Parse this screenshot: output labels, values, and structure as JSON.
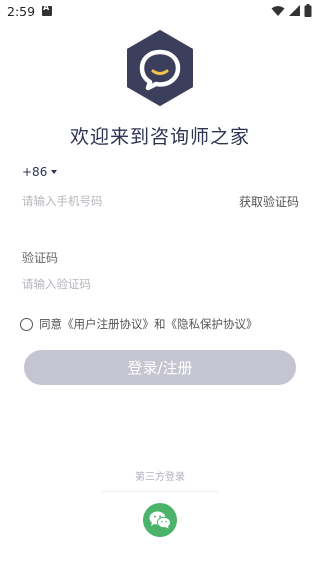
{
  "status_bar": {
    "time": "2:59",
    "notification_icon": "a-badge-icon",
    "icons": [
      "wifi-icon",
      "signal-icon",
      "battery-icon"
    ]
  },
  "logo": {
    "icon": "chat-bubble-logo",
    "color": "#3c3f5c"
  },
  "welcome_title": "欢迎来到咨询师之家",
  "phone": {
    "country_code": "+86",
    "placeholder": "请输入手机号码",
    "get_code_label": "获取验证码"
  },
  "code": {
    "label": "验证码",
    "placeholder": "请输入验证码"
  },
  "agreement": {
    "text": "同意《用户注册协议》和《隐私保护协议》"
  },
  "login_button": {
    "label": "登录/注册",
    "color": "#c4c5d0"
  },
  "third_party": {
    "label": "第三方登录",
    "wechat_color": "#4cb36a"
  }
}
